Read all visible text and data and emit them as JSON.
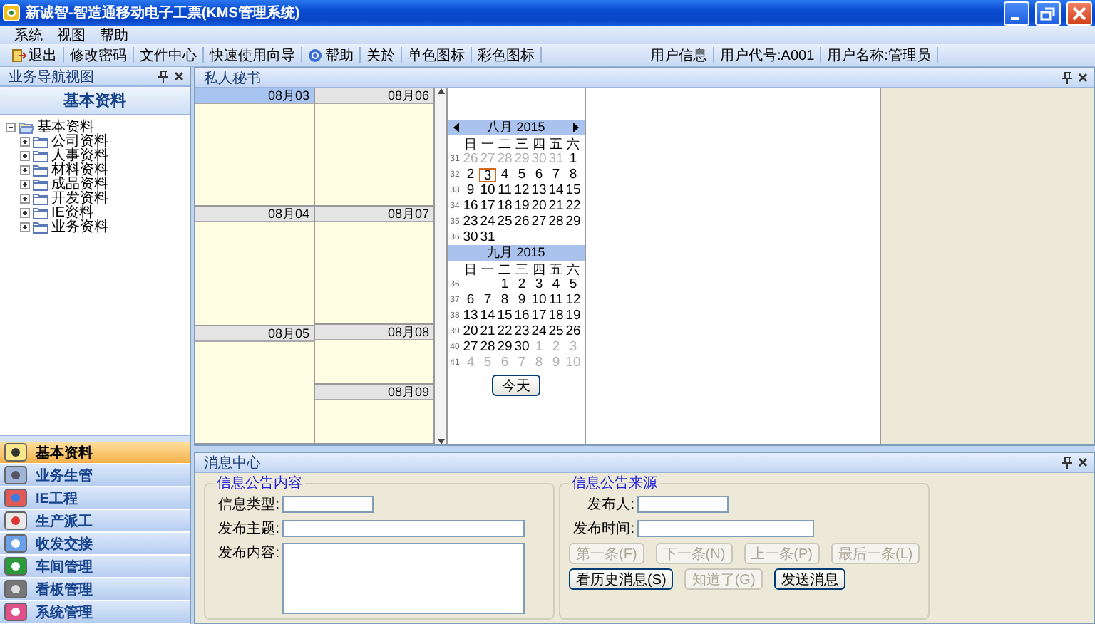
{
  "window": {
    "title": "新诚智-智造通移动电子工票(KMS管理系统)"
  },
  "menu": [
    "系统",
    "视图",
    "帮助"
  ],
  "toolbar": {
    "items": [
      {
        "label": "退出",
        "kind": "icon"
      },
      {
        "label": "修改密码",
        "kind": "text"
      },
      {
        "label": "文件中心",
        "kind": "text"
      },
      {
        "label": "快速使用向导",
        "kind": "text"
      },
      {
        "label": "帮助",
        "kind": "icon"
      },
      {
        "label": "关於",
        "kind": "text"
      },
      {
        "label": "单色图标",
        "kind": "text"
      },
      {
        "label": "彩色图标",
        "kind": "text"
      }
    ],
    "user": [
      "用户信息",
      "用户代号:A001",
      "用户名称:管理员"
    ]
  },
  "nav_panel": {
    "title": "业务导航视图",
    "heading": "基本资料",
    "tree": {
      "label": "基本资料",
      "expanded": true,
      "children": [
        {
          "label": "公司资料",
          "expanded": false
        },
        {
          "label": "人事资料",
          "expanded": false
        },
        {
          "label": "材料资料",
          "expanded": false
        },
        {
          "label": "成品资料",
          "expanded": false
        },
        {
          "label": "开发资料",
          "expanded": false
        },
        {
          "label": "IE资料",
          "expanded": false
        },
        {
          "label": "业务资料",
          "expanded": false
        }
      ]
    },
    "modules": [
      {
        "label": "基本资料",
        "selected": true
      },
      {
        "label": "业务生管",
        "selected": false
      },
      {
        "label": "IE工程",
        "selected": false
      },
      {
        "label": "生产派工",
        "selected": false
      },
      {
        "label": "收发交接",
        "selected": false
      },
      {
        "label": "车间管理",
        "selected": false
      },
      {
        "label": "看板管理",
        "selected": false
      },
      {
        "label": "系统管理",
        "selected": false
      }
    ]
  },
  "secretary": {
    "title": "私人秘书",
    "day_columns": [
      {
        "days": [
          {
            "date": "08月03",
            "kind": "weekday",
            "selected": true
          },
          {
            "date": "08月04",
            "kind": "weekday",
            "selected": false
          },
          {
            "date": "08月05",
            "kind": "weekday",
            "selected": false
          }
        ]
      },
      {
        "days": [
          {
            "date": "08月06",
            "kind": "weekday",
            "selected": false
          },
          {
            "date": "08月07",
            "kind": "weekday",
            "selected": false
          },
          {
            "date": "08月08",
            "kind": "weekend",
            "selected": false
          },
          {
            "date": "08月09",
            "kind": "weekend",
            "selected": false
          }
        ]
      }
    ],
    "calendar": {
      "months": [
        {
          "title": "八月 2015",
          "navigation": true,
          "weekdays": [
            "日",
            "一",
            "二",
            "三",
            "四",
            "五",
            "六"
          ],
          "weeks": [
            {
              "week": "31",
              "days": [
                {
                  "text": "26",
                  "muted": true,
                  "selected": false
                },
                {
                  "text": "27",
                  "muted": true,
                  "selected": false
                },
                {
                  "text": "28",
                  "muted": true,
                  "selected": false
                },
                {
                  "text": "29",
                  "muted": true,
                  "selected": false
                },
                {
                  "text": "30",
                  "muted": true,
                  "selected": false
                },
                {
                  "text": "31",
                  "muted": true,
                  "selected": false
                },
                {
                  "text": "1",
                  "muted": false,
                  "selected": false
                }
              ]
            },
            {
              "week": "32",
              "days": [
                {
                  "text": "2",
                  "muted": false,
                  "selected": false
                },
                {
                  "text": "3",
                  "muted": false,
                  "selected": true
                },
                {
                  "text": "4",
                  "muted": false,
                  "selected": false
                },
                {
                  "text": "5",
                  "muted": false,
                  "selected": false
                },
                {
                  "text": "6",
                  "muted": false,
                  "selected": false
                },
                {
                  "text": "7",
                  "muted": false,
                  "selected": false
                },
                {
                  "text": "8",
                  "muted": false,
                  "selected": false
                }
              ]
            },
            {
              "week": "33",
              "days": [
                {
                  "text": "9",
                  "muted": false,
                  "selected": false
                },
                {
                  "text": "10",
                  "muted": false,
                  "selected": false
                },
                {
                  "text": "11",
                  "muted": false,
                  "selected": false
                },
                {
                  "text": "12",
                  "muted": false,
                  "selected": false
                },
                {
                  "text": "13",
                  "muted": false,
                  "selected": false
                },
                {
                  "text": "14",
                  "muted": false,
                  "selected": false
                },
                {
                  "text": "15",
                  "muted": false,
                  "selected": false
                }
              ]
            },
            {
              "week": "34",
              "days": [
                {
                  "text": "16",
                  "muted": false,
                  "selected": false
                },
                {
                  "text": "17",
                  "muted": false,
                  "selected": false
                },
                {
                  "text": "18",
                  "muted": false,
                  "selected": false
                },
                {
                  "text": "19",
                  "muted": false,
                  "selected": false
                },
                {
                  "text": "20",
                  "muted": false,
                  "selected": false
                },
                {
                  "text": "21",
                  "muted": false,
                  "selected": false
                },
                {
                  "text": "22",
                  "muted": false,
                  "selected": false
                }
              ]
            },
            {
              "week": "35",
              "days": [
                {
                  "text": "23",
                  "muted": false,
                  "selected": false
                },
                {
                  "text": "24",
                  "muted": false,
                  "selected": false
                },
                {
                  "text": "25",
                  "muted": false,
                  "selected": false
                },
                {
                  "text": "26",
                  "muted": false,
                  "selected": false
                },
                {
                  "text": "27",
                  "muted": false,
                  "selected": false
                },
                {
                  "text": "28",
                  "muted": false,
                  "selected": false
                },
                {
                  "text": "29",
                  "muted": false,
                  "selected": false
                }
              ]
            },
            {
              "week": "36",
              "days": [
                {
                  "text": "30",
                  "muted": false,
                  "selected": false
                },
                {
                  "text": "31",
                  "muted": false,
                  "selected": false
                }
              ]
            }
          ]
        },
        {
          "title": "九月 2015",
          "navigation": false,
          "weekdays": [
            "日",
            "一",
            "二",
            "三",
            "四",
            "五",
            "六"
          ],
          "weeks": [
            {
              "week": "36",
              "days": [
                {
                  "text": "1",
                  "muted": false,
                  "selected": false
                },
                {
                  "text": "2",
                  "muted": false,
                  "selected": false
                },
                {
                  "text": "3",
                  "muted": false,
                  "selected": false
                },
                {
                  "text": "4",
                  "muted": false,
                  "selected": false
                },
                {
                  "text": "5",
                  "muted": false,
                  "selected": false
                }
              ]
            },
            {
              "week": "37",
              "days": [
                {
                  "text": "6",
                  "muted": false,
                  "selected": false
                },
                {
                  "text": "7",
                  "muted": false,
                  "selected": false
                },
                {
                  "text": "8",
                  "muted": false,
                  "selected": false
                },
                {
                  "text": "9",
                  "muted": false,
                  "selected": false
                },
                {
                  "text": "10",
                  "muted": false,
                  "selected": false
                },
                {
                  "text": "11",
                  "muted": false,
                  "selected": false
                },
                {
                  "text": "12",
                  "muted": false,
                  "selected": false
                }
              ]
            },
            {
              "week": "38",
              "days": [
                {
                  "text": "13",
                  "muted": false,
                  "selected": false
                },
                {
                  "text": "14",
                  "muted": false,
                  "selected": false
                },
                {
                  "text": "15",
                  "muted": false,
                  "selected": false
                },
                {
                  "text": "16",
                  "muted": false,
                  "selected": false
                },
                {
                  "text": "17",
                  "muted": false,
                  "selected": false
                },
                {
                  "text": "18",
                  "muted": false,
                  "selected": false
                },
                {
                  "text": "19",
                  "muted": false,
                  "selected": false
                }
              ]
            },
            {
              "week": "39",
              "days": [
                {
                  "text": "20",
                  "muted": false,
                  "selected": false
                },
                {
                  "text": "21",
                  "muted": false,
                  "selected": false
                },
                {
                  "text": "22",
                  "muted": false,
                  "selected": false
                },
                {
                  "text": "23",
                  "muted": false,
                  "selected": false
                },
                {
                  "text": "24",
                  "muted": false,
                  "selected": false
                },
                {
                  "text": "25",
                  "muted": false,
                  "selected": false
                },
                {
                  "text": "26",
                  "muted": false,
                  "selected": false
                }
              ]
            },
            {
              "week": "40",
              "days": [
                {
                  "text": "27",
                  "muted": false,
                  "selected": false
                },
                {
                  "text": "28",
                  "muted": false,
                  "selected": false
                },
                {
                  "text": "29",
                  "muted": false,
                  "selected": false
                },
                {
                  "text": "30",
                  "muted": false,
                  "selected": false
                },
                {
                  "text": "1",
                  "muted": true,
                  "selected": false
                },
                {
                  "text": "2",
                  "muted": true,
                  "selected": false
                },
                {
                  "text": "3",
                  "muted": true,
                  "selected": false
                }
              ]
            },
            {
              "week": "41",
              "days": [
                {
                  "text": "4",
                  "muted": true,
                  "selected": false
                },
                {
                  "text": "5",
                  "muted": true,
                  "selected": false
                },
                {
                  "text": "6",
                  "muted": true,
                  "selected": false
                },
                {
                  "text": "7",
                  "muted": true,
                  "selected": false
                },
                {
                  "text": "8",
                  "muted": true,
                  "selected": false
                },
                {
                  "text": "9",
                  "muted": true,
                  "selected": false
                },
                {
                  "text": "10",
                  "muted": true,
                  "selected": false
                }
              ]
            }
          ]
        }
      ],
      "today_button": "今天"
    }
  },
  "messages": {
    "title": "消息中心",
    "content_group": {
      "title": "信息公告内容",
      "fields": [
        {
          "label": "信息类型:",
          "kind": "short"
        },
        {
          "label": "发布主题:",
          "kind": "wide"
        },
        {
          "label": "发布内容:",
          "kind": "area"
        }
      ]
    },
    "source_group": {
      "title": "信息公告来源",
      "fields": [
        {
          "label": "发布人:",
          "kind": "short"
        },
        {
          "label": "发布时间:",
          "kind": "wide"
        }
      ],
      "nav_buttons": [
        {
          "label": "第一条(F)",
          "disabled": true
        },
        {
          "label": "下一条(N)",
          "disabled": true
        },
        {
          "label": "上一条(P)",
          "disabled": true
        },
        {
          "label": "最后一条(L)",
          "disabled": true
        }
      ],
      "action_buttons": [
        {
          "label": "看历史消息(S)",
          "disabled": false
        },
        {
          "label": "知道了(G)",
          "disabled": true
        },
        {
          "label": "发送消息",
          "disabled": false
        }
      ]
    }
  }
}
